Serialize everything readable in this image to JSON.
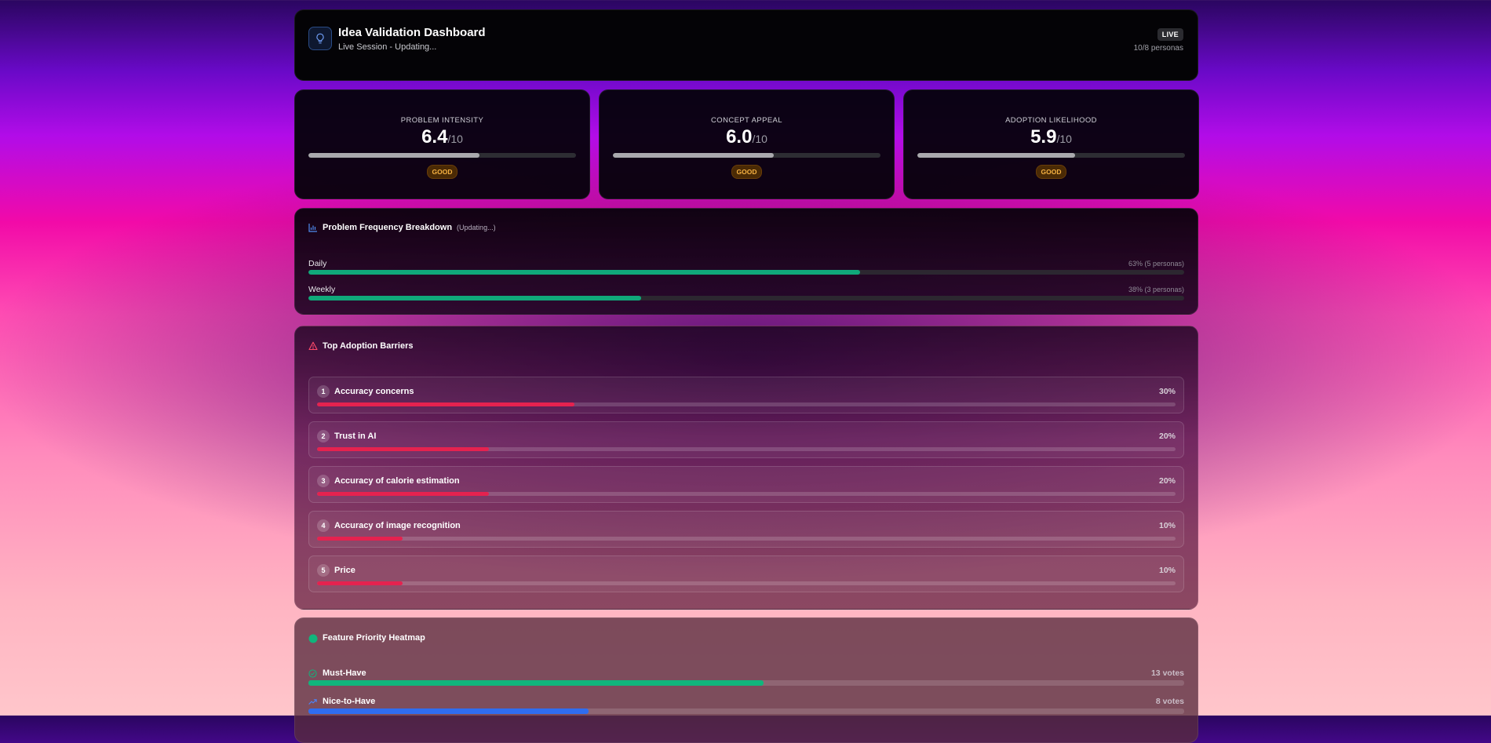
{
  "header": {
    "title": "Idea Validation Dashboard",
    "subtitle": "Live Session - Updating...",
    "live_badge": "LIVE",
    "personas": "10/8 personas"
  },
  "metrics": [
    {
      "label": "PROBLEM INTENSITY",
      "value": "6.4",
      "denominator": "/10",
      "fill": 0.64,
      "badge": "GOOD"
    },
    {
      "label": "CONCEPT APPEAL",
      "value": "6.0",
      "denominator": "/10",
      "fill": 0.6,
      "badge": "GOOD"
    },
    {
      "label": "ADOPTION LIKELIHOOD",
      "value": "5.9",
      "denominator": "/10",
      "fill": 0.59,
      "badge": "GOOD"
    }
  ],
  "frequency": {
    "title": "Problem Frequency Breakdown",
    "note": "(Updating...)",
    "rows": [
      {
        "label": "Daily",
        "meta": "63% (5 personas)",
        "fill": 0.63
      },
      {
        "label": "Weekly",
        "meta": "38% (3 personas)",
        "fill": 0.38
      }
    ]
  },
  "barriers": {
    "title": "Top Adoption Barriers",
    "items": [
      {
        "rank": "1",
        "name": "Accuracy concerns",
        "pct": "30%",
        "fill": 0.3
      },
      {
        "rank": "2",
        "name": "Trust in AI",
        "pct": "20%",
        "fill": 0.2
      },
      {
        "rank": "3",
        "name": "Accuracy of calorie estimation",
        "pct": "20%",
        "fill": 0.2
      },
      {
        "rank": "4",
        "name": "Accuracy of image recognition",
        "pct": "10%",
        "fill": 0.1
      },
      {
        "rank": "5",
        "name": "Price",
        "pct": "10%",
        "fill": 0.1
      }
    ]
  },
  "heatmap": {
    "title": "Feature Priority Heatmap",
    "rows": [
      {
        "label": "Must-Have",
        "votes": "13 votes",
        "fill": 0.52,
        "color": "#10b57c",
        "icon": "check-circle-icon"
      },
      {
        "label": "Nice-to-Have",
        "votes": "8 votes",
        "fill": 0.32,
        "color": "#2f6df0",
        "icon": "trending-up-icon"
      }
    ]
  },
  "colors": {
    "good_badge": "#f5b042",
    "barrier_bar": "#e5224f",
    "frequency_bar": "#10a87a",
    "header_icon_accent": "#6f9df5"
  }
}
